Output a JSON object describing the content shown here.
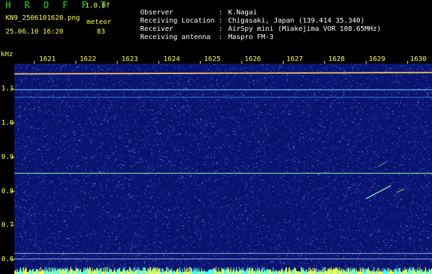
{
  "app": {
    "title": "H R O F F T",
    "version": "1.0.0f"
  },
  "capture": {
    "file_name": "KN9_2506101620.png",
    "date_time": "25.06.10 16:20",
    "meteor_label": "meteor",
    "meteor_count": "83"
  },
  "info": [
    {
      "key": "Observer",
      "value": "K.Nagai"
    },
    {
      "key": "Receiving Location",
      "value": "Chigasaki, Japan (139.414 35.340)"
    },
    {
      "key": "Receiver",
      "value": "AirSpy mini (Miakejima VOR 108.65MHz)"
    },
    {
      "key": "Receiving antenna",
      "value": "Maspro FM-3"
    }
  ],
  "axes": {
    "y_unit": "kHz",
    "y_ticks": [
      "1.1",
      "1.0",
      "0.9",
      "0.8",
      "0.7",
      "0.6"
    ],
    "x_ticks": [
      "1621",
      "1622",
      "1623",
      "1624",
      "1625",
      "1626",
      "1627",
      "1628",
      "1629",
      "1630"
    ]
  },
  "colors": {
    "title": "#22e022",
    "label": "#ffff40",
    "info": "#ffffff",
    "background": "#0a1470",
    "line": "#7fd3ff"
  }
}
